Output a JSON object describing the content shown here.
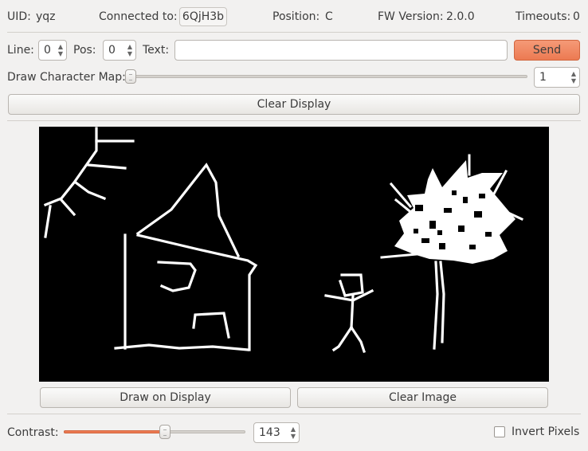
{
  "header": {
    "uid_label": "UID:",
    "uid_value": "yqz",
    "connected_label": "Connected to:",
    "connected_value": "6QjH3b",
    "position_label": "Position:",
    "position_value": "C",
    "fw_label": "FW Version:",
    "fw_value": "2.0.0",
    "timeouts_label": "Timeouts:",
    "timeouts_value": "0"
  },
  "text_row": {
    "line_label": "Line:",
    "line_value": "0",
    "pos_label": "Pos:",
    "pos_value": "0",
    "text_label": "Text:",
    "text_value": "",
    "send_label": "Send"
  },
  "char_map": {
    "label": "Draw Character Map:",
    "slider_value": 1,
    "spin_value": "1"
  },
  "clear_display_label": "Clear Display",
  "image_panel": {
    "draw_label": "Draw on Display",
    "clear_label": "Clear Image"
  },
  "contrast": {
    "label": "Contrast:",
    "value": "143",
    "fraction": 0.56
  },
  "invert": {
    "label": "Invert Pixels",
    "checked": false
  },
  "colors": {
    "accent": "#ec7a52",
    "canvas_bg": "#000000",
    "canvas_fg": "#ffffff",
    "window_bg": "#f2f1f0"
  }
}
